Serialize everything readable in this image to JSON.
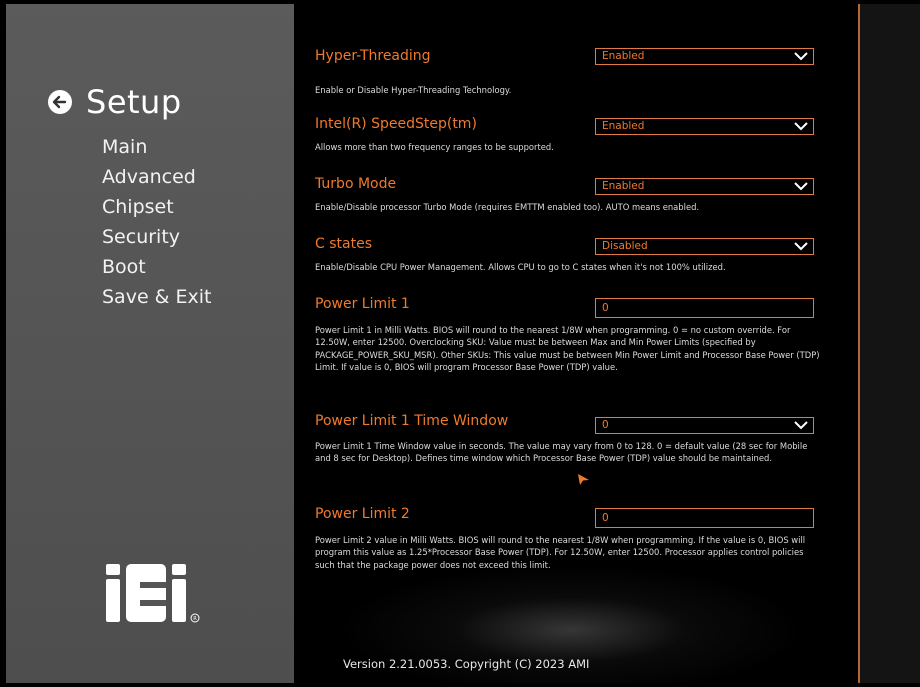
{
  "sidebar": {
    "title": "Setup",
    "items": [
      {
        "label": "Main"
      },
      {
        "label": "Advanced"
      },
      {
        "label": "Chipset"
      },
      {
        "label": "Security"
      },
      {
        "label": "Boot"
      },
      {
        "label": "Save & Exit"
      }
    ],
    "logo_text": "iEi"
  },
  "settings": [
    {
      "label": "Hyper-Threading",
      "value": "Enabled",
      "desc": "Enable or Disable Hyper-Threading Technology."
    },
    {
      "label": "Intel(R) SpeedStep(tm)",
      "value": "Enabled",
      "desc": "Allows more than two frequency ranges to be supported."
    },
    {
      "label": "Turbo Mode",
      "value": "Enabled",
      "desc": "Enable/Disable processor Turbo Mode (requires EMTTM enabled too). AUTO means enabled."
    },
    {
      "label": "C states",
      "value": "Disabled",
      "desc": "Enable/Disable CPU Power Management. Allows CPU to go to C states when it's not 100% utilized."
    },
    {
      "label": "Power Limit 1",
      "value": "0",
      "desc": "Power Limit 1 in Milli Watts. BIOS will round to the nearest 1/8W when programming. 0 = no custom override. For 12.50W, enter 12500. Overclocking SKU: Value must be between Max and Min Power Limits (specified by PACKAGE_POWER_SKU_MSR). Other SKUs: This value must be between Min Power Limit and Processor Base Power (TDP) Limit. If value is 0, BIOS will program Processor Base Power (TDP) value."
    },
    {
      "label": "Power Limit 1 Time Window",
      "value": "0",
      "desc": "Power Limit 1 Time Window value in seconds. The value may vary from 0 to 128. 0 = default value (28 sec for Mobile and 8 sec for Desktop). Defines time window which Processor Base Power (TDP) value should be maintained."
    },
    {
      "label": "Power Limit 2",
      "value": "0",
      "desc": "Power Limit 2 value in Milli Watts. BIOS will round to the nearest 1/8W when programming. If the value is 0, BIOS will program this value as 1.25*Processor Base Power (TDP). For 12.50W, enter 12500. Processor applies control policies such that the package power does not exceed this limit."
    }
  ],
  "footer": {
    "version": "Version 2.21.0053. Copyright (C) 2023 AMI"
  },
  "colors": {
    "accent": "#f07a2c",
    "border": "#e07a45",
    "sidebar_bg": "#555555"
  }
}
